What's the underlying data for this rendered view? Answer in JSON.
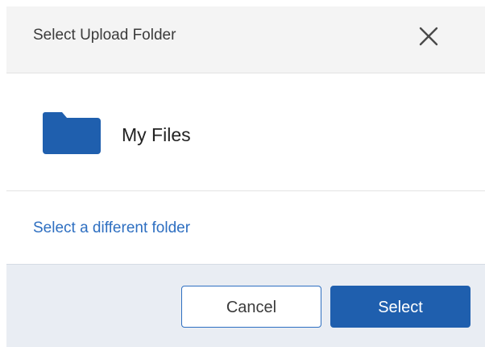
{
  "dialog": {
    "title": "Select Upload Folder"
  },
  "folder": {
    "name": "My Files"
  },
  "change_folder_link": "Select a different folder",
  "buttons": {
    "cancel_label": "Cancel",
    "select_label": "Select"
  },
  "icons": {
    "close": "close-icon",
    "folder": "folder-icon"
  },
  "colors": {
    "accent": "#1f5fae",
    "link": "#2e6fc1",
    "header_bg": "#f4f4f4",
    "footer_bg": "#e9edf3"
  }
}
